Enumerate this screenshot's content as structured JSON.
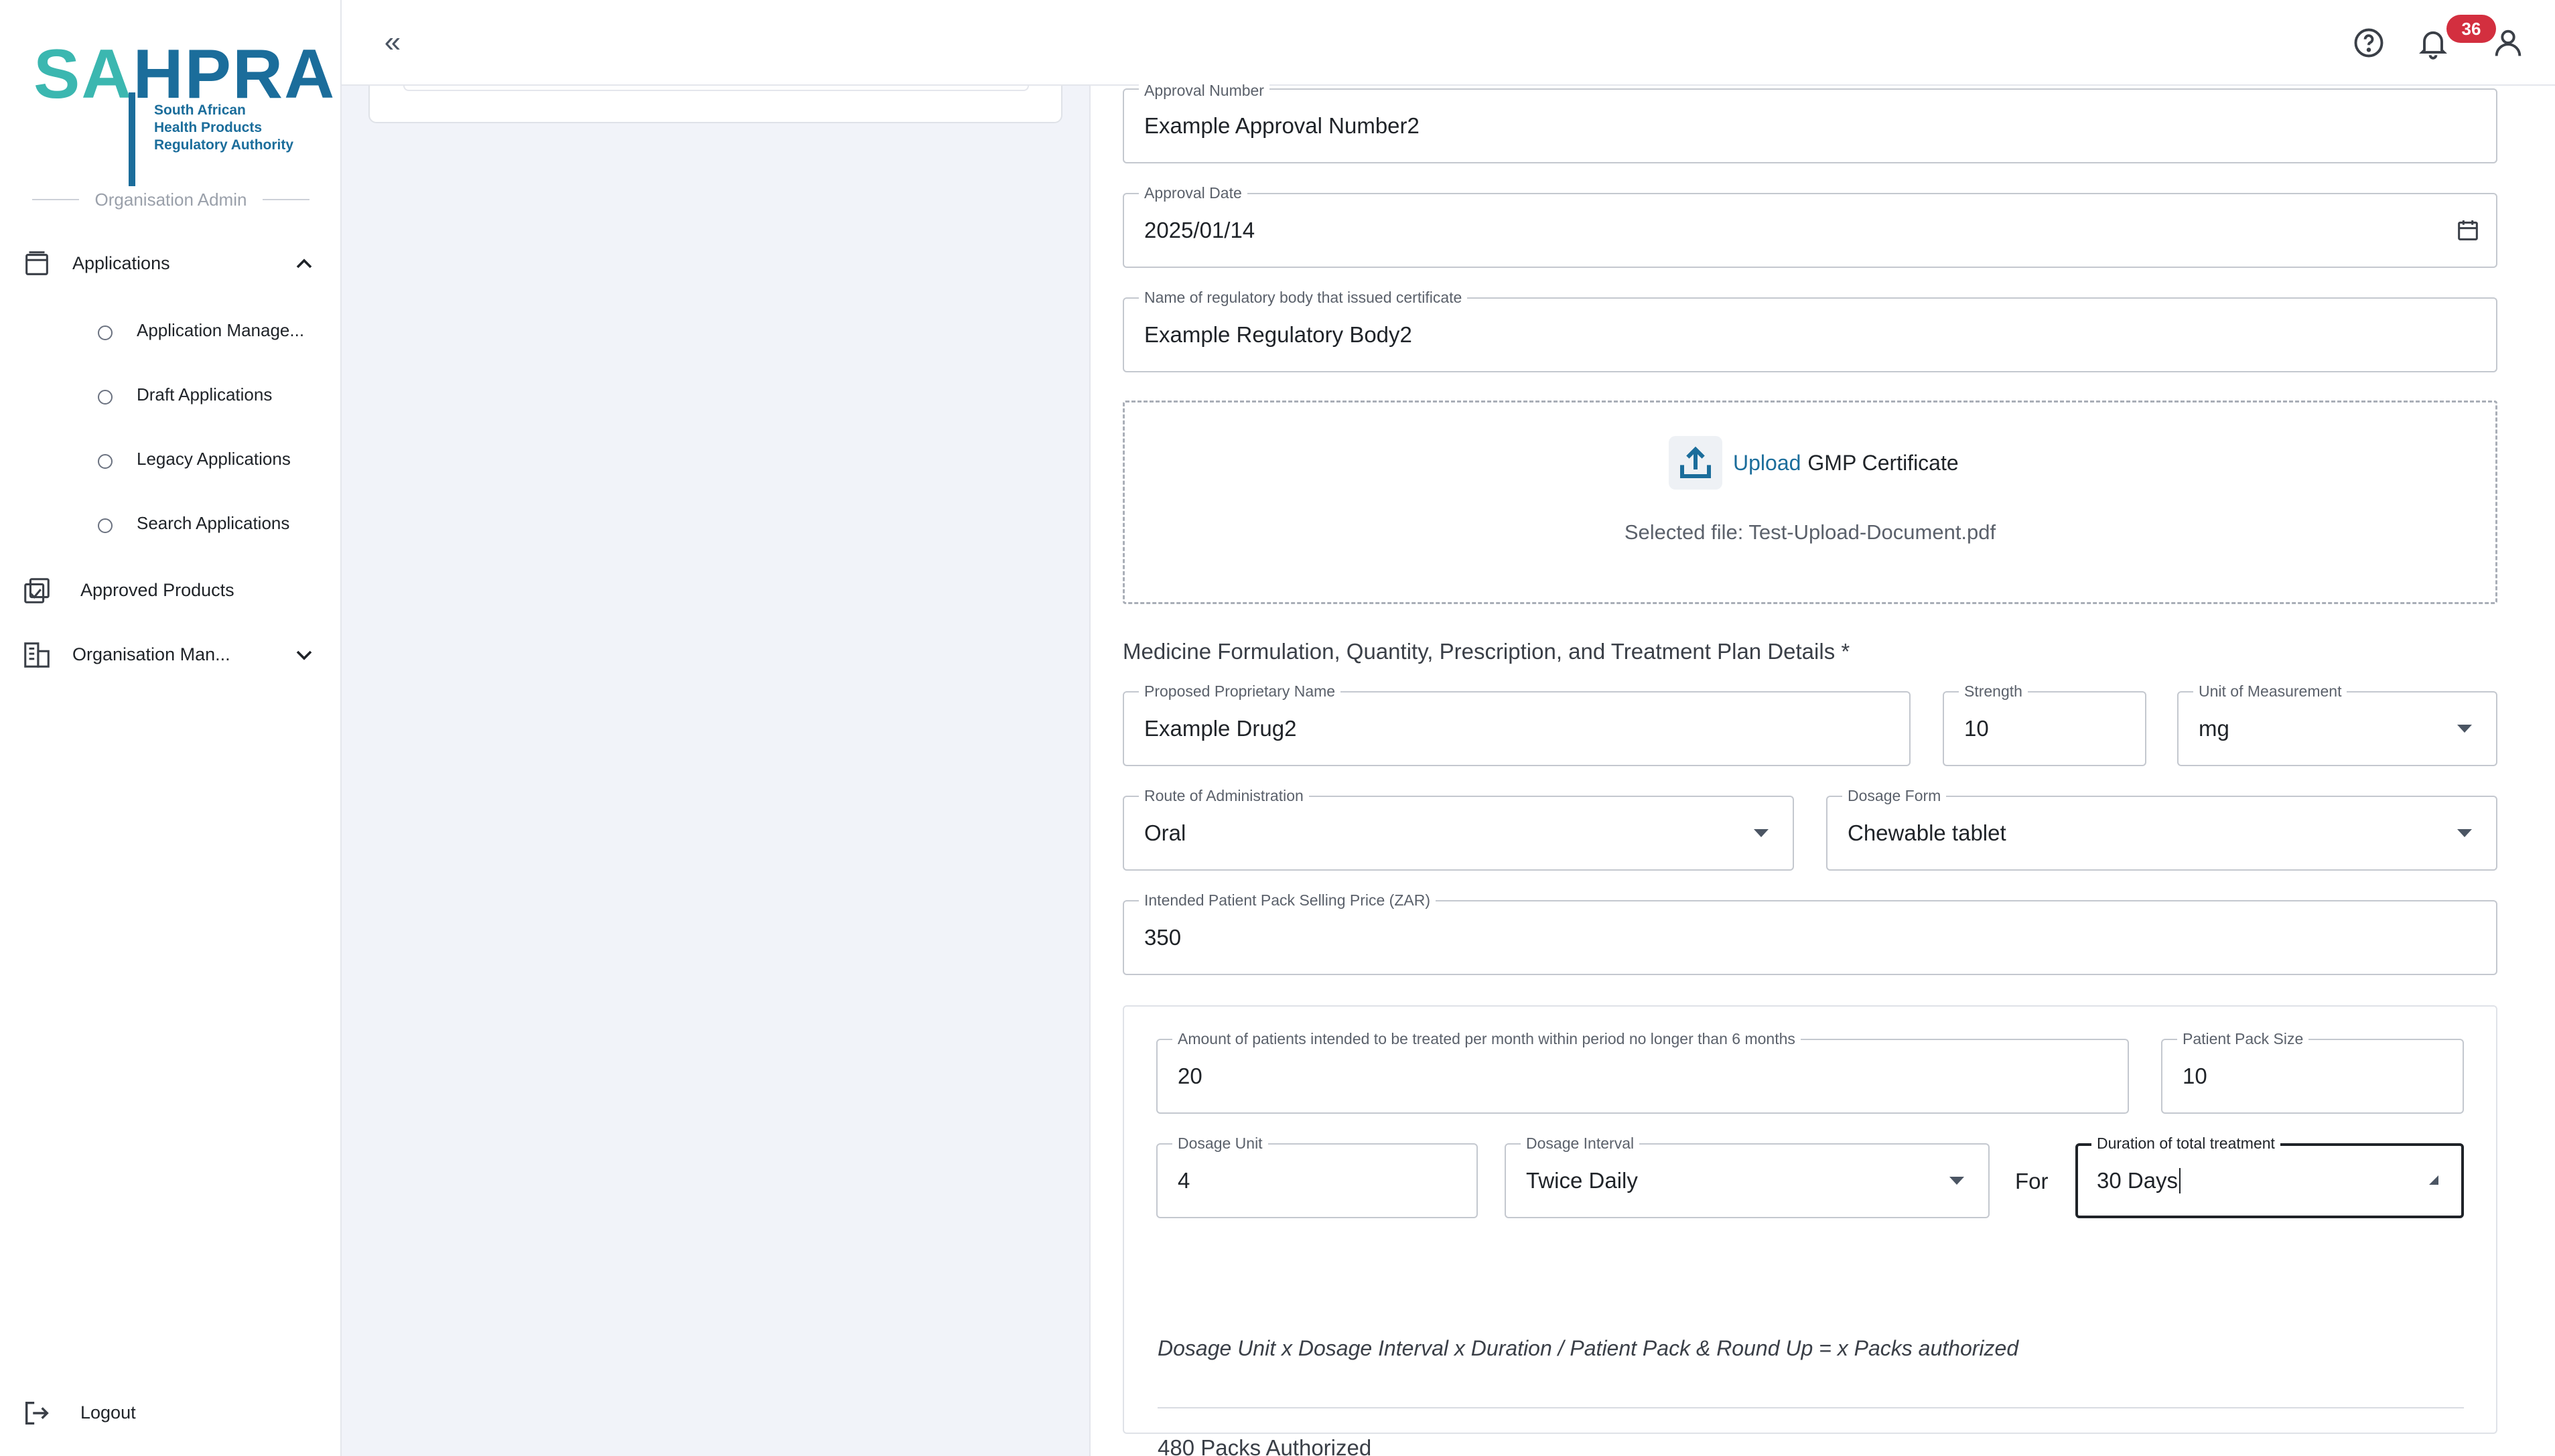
{
  "brand": {
    "logo_sa": "SA",
    "logo_hpra": "HPRA",
    "logo_sub_1": "South African",
    "logo_sub_2": "Health Products",
    "logo_sub_3": "Regulatory Authority"
  },
  "sidebar": {
    "role_label": "Organisation Admin",
    "applications_label": "Applications",
    "sub_items": [
      {
        "label": "Application Manage..."
      },
      {
        "label": "Draft Applications"
      },
      {
        "label": "Legacy Applications"
      },
      {
        "label": "Search Applications"
      }
    ],
    "approved_products_label": "Approved Products",
    "org_management_label": "Organisation Man...",
    "logout_label": "Logout"
  },
  "header": {
    "collapse_glyph": "«",
    "notification_count": "36"
  },
  "form": {
    "approval_number": {
      "label": "Approval Number",
      "value": "Example Approval Number2"
    },
    "approval_date": {
      "label": "Approval Date",
      "value": "2025/01/14"
    },
    "regulatory_body": {
      "label": "Name of regulatory body that issued certificate",
      "value": "Example Regulatory Body2"
    },
    "upload": {
      "link": "Upload",
      "rest": "GMP Certificate",
      "selected_file": "Selected file: Test-Upload-Document.pdf"
    },
    "section_title": "Medicine Formulation, Quantity, Prescription, and Treatment Plan Details *",
    "proprietary_name": {
      "label": "Proposed Proprietary Name",
      "value": "Example Drug2"
    },
    "strength": {
      "label": "Strength",
      "value": "10"
    },
    "unit_of_measurement": {
      "label": "Unit of Measurement",
      "value": "mg"
    },
    "route": {
      "label": "Route of Administration",
      "value": "Oral"
    },
    "dosage_form": {
      "label": "Dosage Form",
      "value": "Chewable tablet"
    },
    "price": {
      "label": "Intended Patient Pack Selling Price (ZAR)",
      "value": "350"
    },
    "patients": {
      "label": "Amount of patients intended to be treated per month within period no longer than 6 months",
      "value": "20"
    },
    "pack_size": {
      "label": "Patient Pack Size",
      "value": "10"
    },
    "dosage_unit": {
      "label": "Dosage Unit",
      "value": "4"
    },
    "dosage_interval": {
      "label": "Dosage Interval",
      "value": "Twice Daily"
    },
    "for_label": "For",
    "duration": {
      "label": "Duration of total treatment",
      "value": "30 Days"
    },
    "formula": "Dosage Unit x Dosage Interval x Duration / Patient Pack & Round Up = x Packs authorized",
    "packs_authorized": "480 Packs Authorized"
  },
  "colors": {
    "brand_teal": "#3bb7b0",
    "brand_blue": "#1b6d9b",
    "badge_red": "#d32f3f",
    "page_bg": "#f1f3f9"
  }
}
